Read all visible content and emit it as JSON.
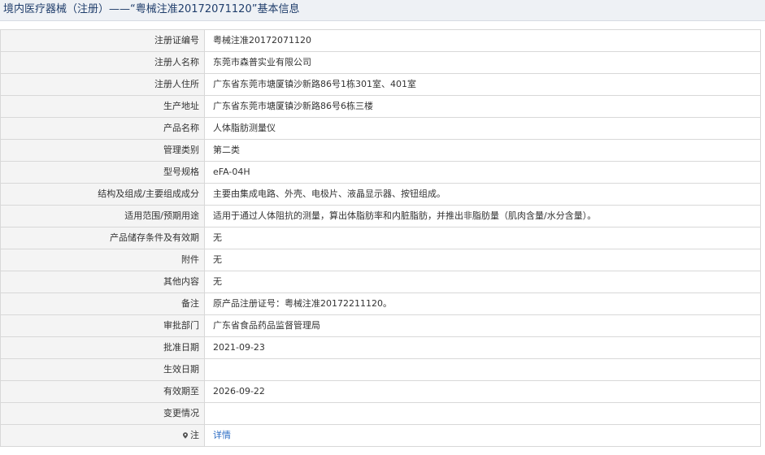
{
  "header": {
    "title": "境内医疗器械（注册）——“粤械注准20172071120”基本信息"
  },
  "rows": [
    {
      "label": "注册证编号",
      "value": "粤械注准20172071120"
    },
    {
      "label": "注册人名称",
      "value": "东莞市森普实业有限公司"
    },
    {
      "label": "注册人住所",
      "value": "广东省东莞市塘厦镇沙新路86号1栋301室、401室"
    },
    {
      "label": "生产地址",
      "value": "广东省东莞市塘厦镇沙新路86号6栋三楼"
    },
    {
      "label": "产品名称",
      "value": "人体脂肪测量仪"
    },
    {
      "label": "管理类别",
      "value": "第二类"
    },
    {
      "label": "型号规格",
      "value": "eFA-04H"
    },
    {
      "label": "结构及组成/主要组成成分",
      "value": "主要由集成电路、外壳、电极片、液晶显示器、按钮组成。"
    },
    {
      "label": "适用范围/预期用途",
      "value": "适用于通过人体阻抗的测量，算出体脂肪率和内脏脂肪，并推出非脂肪量（肌肉含量/水分含量）。"
    },
    {
      "label": "产品储存条件及有效期",
      "value": "无"
    },
    {
      "label": "附件",
      "value": "无"
    },
    {
      "label": "其他内容",
      "value": "无"
    },
    {
      "label": "备注",
      "value": "原产品注册证号：粤械注准20172211120。"
    },
    {
      "label": "审批部门",
      "value": "广东省食品药品监督管理局"
    },
    {
      "label": "批准日期",
      "value": "2021-09-23"
    },
    {
      "label": "生效日期",
      "value": ""
    },
    {
      "label": "有效期至",
      "value": "2026-09-22"
    },
    {
      "label": "变更情况",
      "value": ""
    }
  ],
  "note_row": {
    "label": "注",
    "link_text": "详情",
    "icon": "location-pin-icon"
  },
  "colors": {
    "title_text": "#1f3d6b",
    "label_bg": "#f4f4f4",
    "border": "#d8d8d8",
    "link": "#2b6cc4"
  }
}
